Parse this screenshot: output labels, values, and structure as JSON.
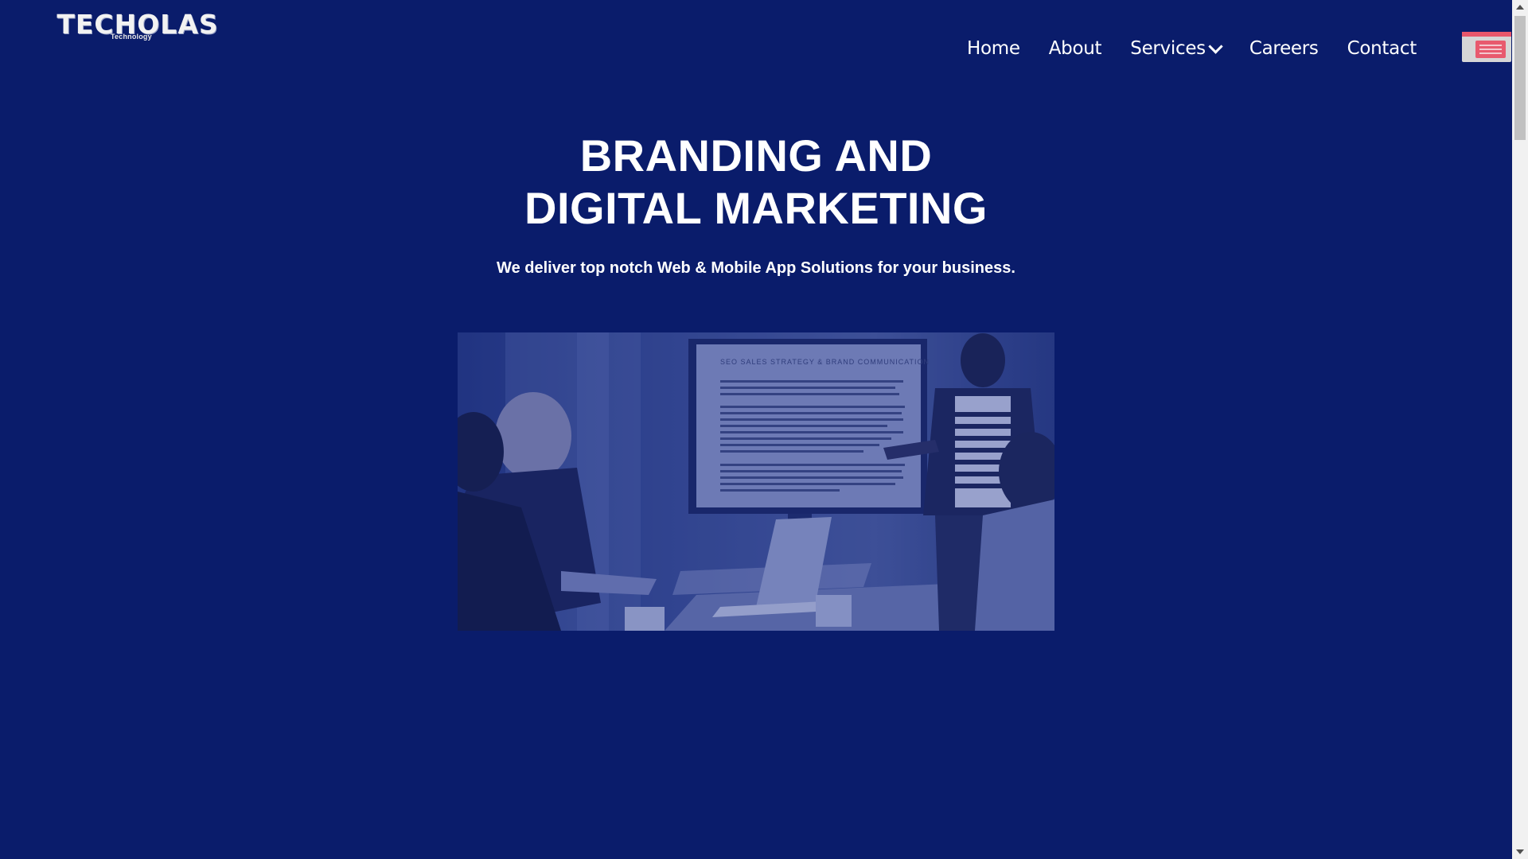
{
  "header": {
    "logo_text": "TECHOLAS",
    "logo_subtext": "Technology",
    "nav": {
      "home": "Home",
      "about": "About",
      "services": "Services",
      "careers": "Careers",
      "contact": "Contact"
    },
    "menu_icon": "menu-toggle-icon"
  },
  "hero": {
    "title_line1": "BRANDING AND",
    "title_line2": "DIGITAL MARKETING",
    "subtitle": "We deliver top notch Web & Mobile App Solutions for your business.",
    "image_screen_heading": "SEO SALES STRATEGY & BRAND COMMUNICATION"
  },
  "colors": {
    "background": "#0a1c6b",
    "text": "#ffffff",
    "menu_accent": "#e8576b"
  }
}
